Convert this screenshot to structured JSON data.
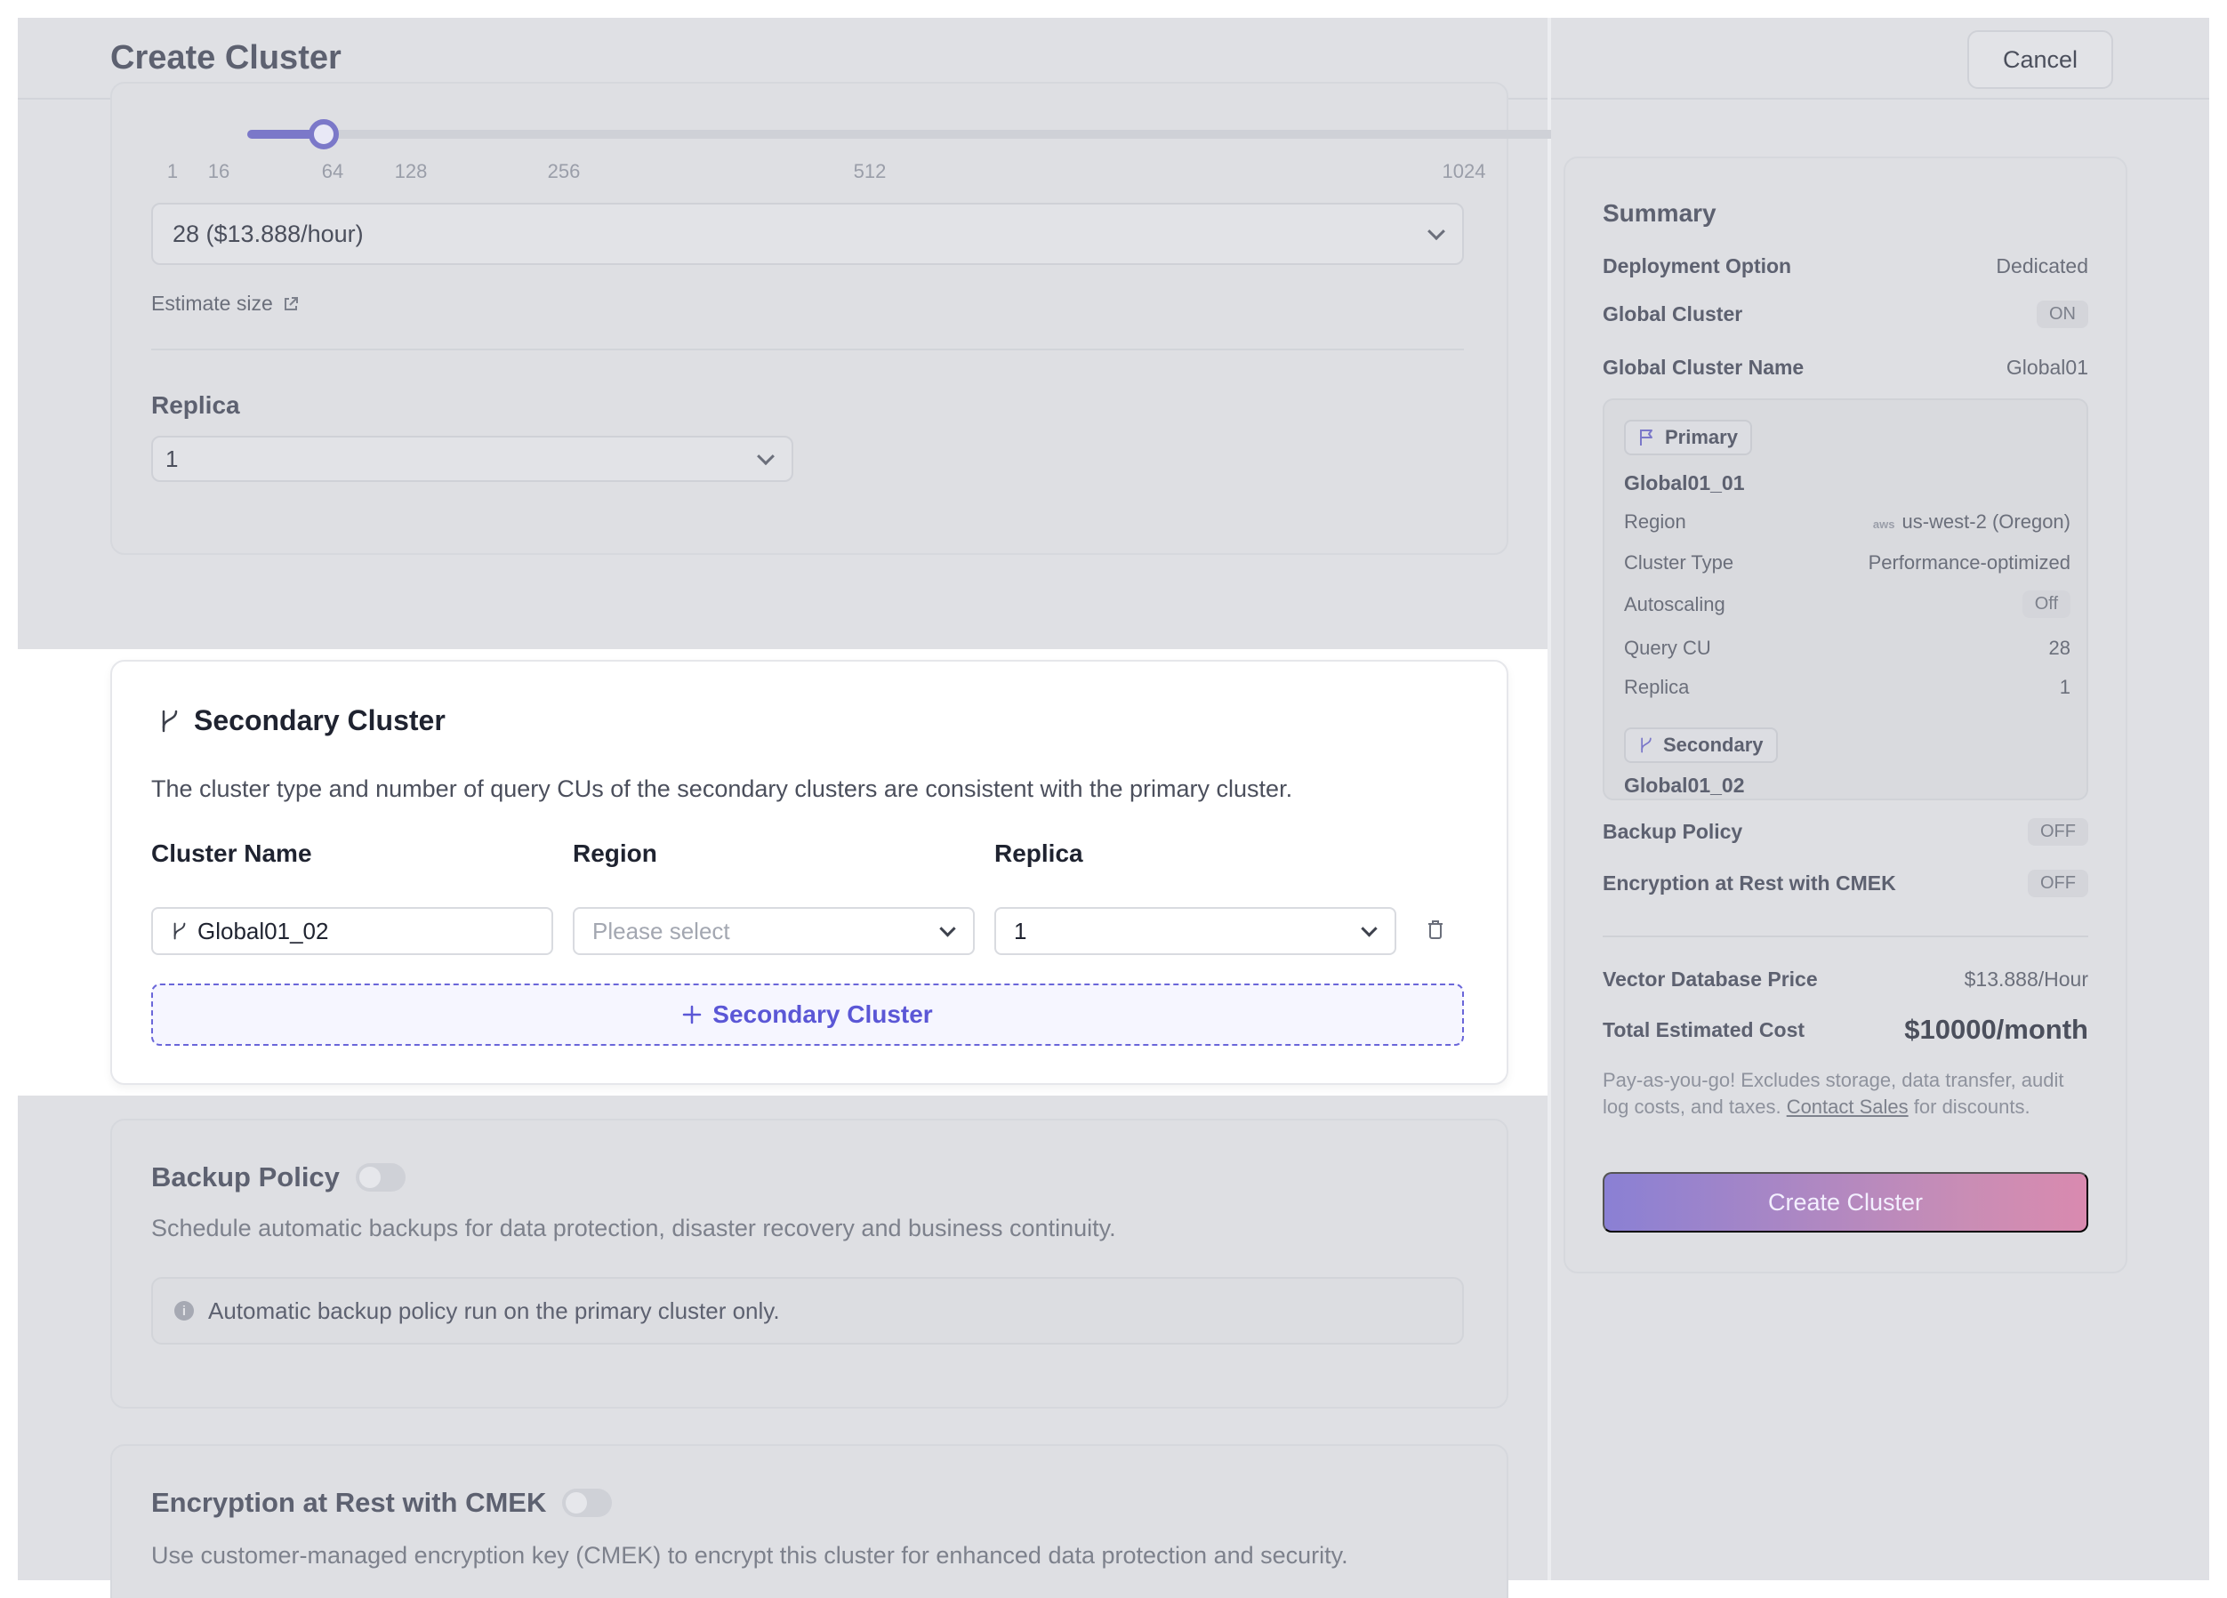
{
  "header": {
    "title": "Create Cluster",
    "cancel_label": "Cancel"
  },
  "query_cu": {
    "slider_ticks": [
      "1",
      "16",
      "64",
      "128",
      "256",
      "512",
      "1024"
    ],
    "selected_value": "28 ($13.888/hour)",
    "slider_fraction": 0.0586,
    "estimate_link": "Estimate size"
  },
  "replica": {
    "label": "Replica",
    "value": "1"
  },
  "secondary": {
    "title": "Secondary Cluster",
    "description": "The cluster type and number of query CUs of the secondary clusters are consistent with the primary cluster.",
    "col_name": "Cluster Name",
    "col_region": "Region",
    "col_replica": "Replica",
    "row": {
      "name": "Global01_02",
      "region_placeholder": "Please select",
      "replica": "1"
    },
    "add_label": "Secondary Cluster"
  },
  "backup": {
    "title": "Backup Policy",
    "description": "Schedule automatic backups for data protection, disaster recovery and business continuity.",
    "note": "Automatic backup policy run on the primary cluster only."
  },
  "encryption": {
    "title": "Encryption at Rest with CMEK",
    "description": "Use customer-managed encryption key (CMEK) to encrypt this cluster for enhanced data protection and security."
  },
  "summary": {
    "title": "Summary",
    "deployment_option_label": "Deployment Option",
    "deployment_option_value": "Dedicated",
    "global_cluster_label": "Global Cluster",
    "global_cluster_value": "ON",
    "global_cluster_name_label": "Global Cluster Name",
    "global_cluster_name_value": "Global01",
    "primary": {
      "tag": "Primary",
      "name": "Global01_01",
      "region_label": "Region",
      "region_provider": "aws",
      "region_value": "us-west-2 (Oregon)",
      "cluster_type_label": "Cluster Type",
      "cluster_type_value": "Performance-optimized",
      "autoscaling_label": "Autoscaling",
      "autoscaling_value": "Off",
      "query_cu_label": "Query CU",
      "query_cu_value": "28",
      "replica_label": "Replica",
      "replica_value": "1"
    },
    "secondary": {
      "tag": "Secondary",
      "name": "Global01_02"
    },
    "backup_label": "Backup Policy",
    "backup_value": "OFF",
    "encryption_label": "Encryption at Rest with CMEK",
    "encryption_value": "OFF",
    "price_label": "Vector Database Price",
    "price_value": "$13.888/Hour",
    "total_label": "Total Estimated Cost",
    "total_value": "$10000/month",
    "note_before": "Pay-as-you-go! Excludes storage, data transfer, audit log costs, and taxes.",
    "note_link": "Contact Sales",
    "note_after": "for discounts.",
    "create_label": "Create Cluster"
  },
  "colors": {
    "accent": "#5b57d6",
    "slider": "#7b78c9",
    "gradient_start": "#8a80d4",
    "gradient_end": "#d98aaf"
  }
}
